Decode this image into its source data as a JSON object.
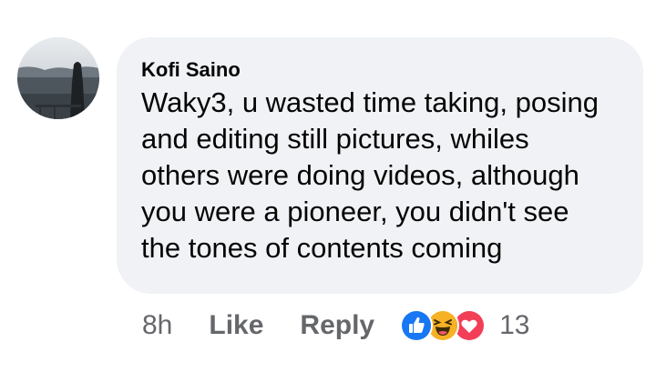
{
  "comment": {
    "author": "Kofi Saino",
    "text": "Waky3, u wasted time taking, posing\nand editing still pictures, whiles\nothers were doing videos, although\nyou were a pioneer, you  didn't see\nthe tones of contents coming",
    "time": "8h",
    "like_label": "Like",
    "reply_label": "Reply",
    "reaction_count": "13",
    "reactions": [
      "like-icon",
      "haha-icon",
      "love-icon"
    ]
  },
  "colors": {
    "bubble": "#f0f2f5",
    "text": "#050505",
    "secondary": "#65676b",
    "like_blue": "#1877f2",
    "haha_yellow": "#f7b125",
    "love_red": "#f33e58"
  }
}
